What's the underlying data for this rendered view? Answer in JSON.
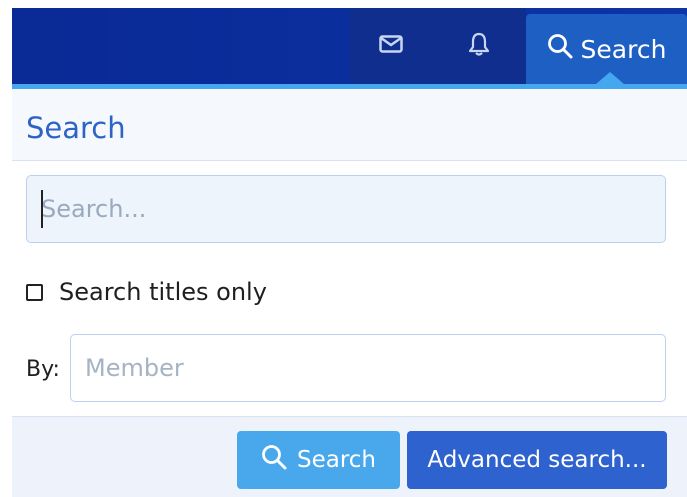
{
  "nav": {
    "inbox_icon": "envelope-icon",
    "alerts_icon": "bell-icon",
    "search_icon": "search-icon",
    "search_label": "Search"
  },
  "panel": {
    "title": "Search",
    "search_placeholder": "Search...",
    "titles_only_label": "Search titles only",
    "titles_only_checked": false,
    "by_label": "By:",
    "member_placeholder": "Member",
    "submit_label": "Search",
    "advanced_label": "Advanced search..."
  },
  "colors": {
    "nav_bg": "#0b2f9f",
    "accent": "#44a7f0",
    "primary_button": "#49a8ec",
    "secondary_button": "#2e62cf",
    "title_text": "#2d63c7"
  }
}
